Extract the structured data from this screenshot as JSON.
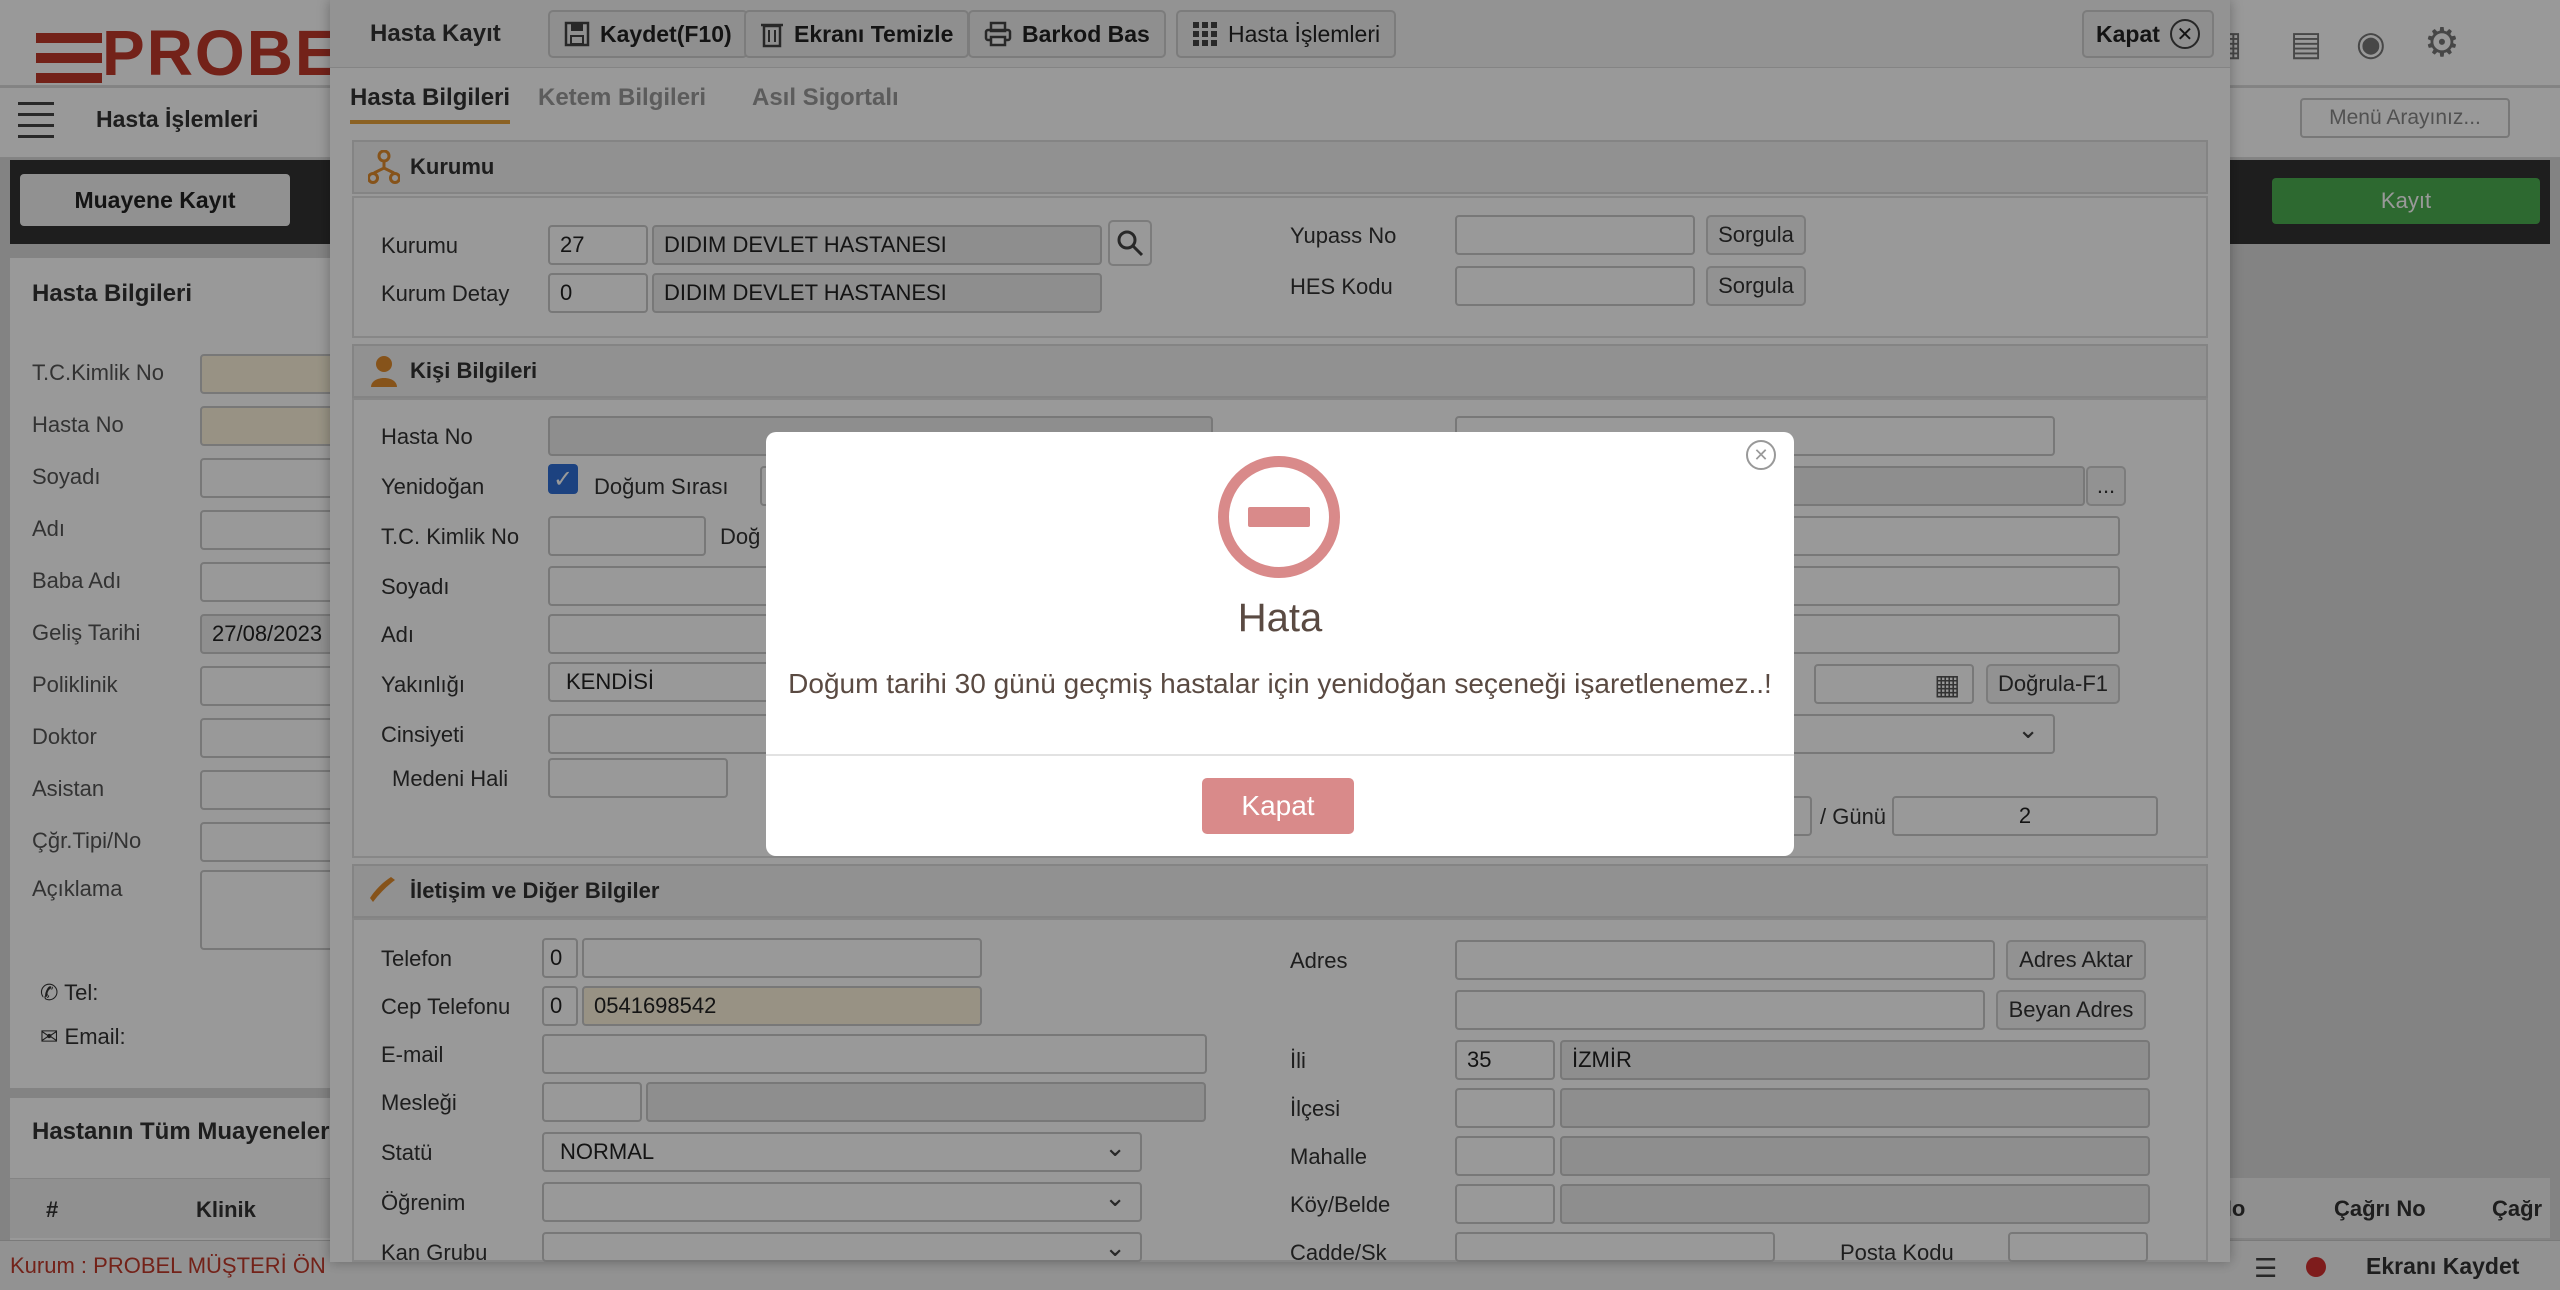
{
  "app": {
    "logo": "PROBEL",
    "module_title": "Hasta İşlemleri",
    "menu_search_placeholder": "Menü Arayınız...",
    "muayene_button": "Muayene Kayıt",
    "kayit_button": "Kayıt"
  },
  "left_panel": {
    "title": "Hasta Bilgileri",
    "fields": [
      "T.C.Kimlik No",
      "Hasta No",
      "Soyadı",
      "Adı",
      "Baba Adı",
      "Geliş Tarihi",
      "Poliklinik",
      "Doktor",
      "Asistan",
      "Çğr.Tipi/No",
      "Açıklama"
    ],
    "gelis_tarihi": "27/08/2023",
    "tel_label": "Tel:",
    "email_label": "Email:",
    "history_title": "Hastanın Tüm Muayeneler",
    "table_headers": [
      "#",
      "Klinik",
      "No",
      "Çağrı No",
      "Çağr"
    ]
  },
  "footer": {
    "kurum_label": "Kurum :",
    "kurum_value": "PROBEL MÜŞTERİ ÖN",
    "save_screen": "Ekranı Kaydet"
  },
  "dialog": {
    "title": "Hasta Kayıt",
    "toolbar": {
      "save": "Kaydet(F10)",
      "clear": "Ekranı Temizle",
      "barcode": "Barkod Bas",
      "patient_ops": "Hasta İşlemleri",
      "close": "Kapat"
    },
    "tabs": [
      "Hasta Bilgileri",
      "Ketem Bilgileri",
      "Asıl Sigortalı"
    ],
    "kurumu_section": {
      "title": "Kurumu",
      "kurumu_label": "Kurumu",
      "kurumu_code": "27",
      "kurumu_name": "DIDIM DEVLET HASTANESI",
      "detay_label": "Kurum Detay",
      "detay_code": "0",
      "detay_name": "DIDIM DEVLET HASTANESI",
      "yupass_label": "Yupass No",
      "hes_label": "HES Kodu",
      "sorgula": "Sorgula"
    },
    "kisi_section": {
      "title": "Kişi Bilgileri",
      "hasta_no": "Hasta No",
      "yenidogan": "Yenidoğan",
      "dogum_sirasi": "Doğum Sırası",
      "tc": "T.C. Kimlik No",
      "dog_partial": "Doğ",
      "soyadi": "Soyadı",
      "adi": "Adı",
      "yakinligi": "Yakınlığı",
      "yakinligi_value": "KENDİSİ",
      "cinsiyeti": "Cinsiyeti",
      "medeni": "Medeni Hali",
      "dogrula": "Doğrula-F1",
      "gunu_label": "/ Günü",
      "gunu_value": "2",
      "ellipsis": "..."
    },
    "iletisim_section": {
      "title": "İletişim ve Diğer Bilgiler",
      "telefon": "Telefon",
      "tel_code": "0",
      "cep": "Cep Telefonu",
      "cep_code": "0",
      "cep_value": "0541698542",
      "email": "E-mail",
      "meslegi": "Mesleği",
      "statu": "Statü",
      "statu_value": "NORMAL",
      "ogrenim": "Öğrenim",
      "kan": "Kan Grubu",
      "adres": "Adres",
      "adres_aktar": "Adres Aktar",
      "beyan_adres": "Beyan Adres",
      "ili": "İli",
      "il_code": "35",
      "il_name": "İZMİR",
      "ilcesi": "İlçesi",
      "mahalle": "Mahalle",
      "koy": "Köy/Belde",
      "cadde": "Cadde/Sk",
      "posta": "Posta Kodu"
    }
  },
  "alert": {
    "title": "Hata",
    "message": "Doğum tarihi 30 günü geçmiş hastalar için yenidoğan seçeneği işaretlenemez..!",
    "button": "Kapat"
  },
  "colors": {
    "brand_red": "#c0392b",
    "alert_red": "#d98a8a",
    "tab_underline": "#e8a33c",
    "alert_text": "#5a4a42"
  }
}
